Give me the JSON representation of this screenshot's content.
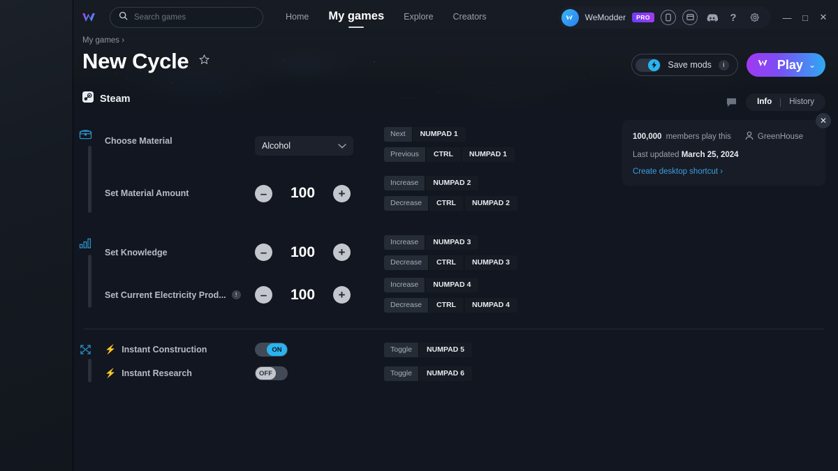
{
  "window": {
    "minimize": "—",
    "maximize": "□",
    "close": "✕"
  },
  "topbar": {
    "logo_icon": "wemod-logo-icon",
    "search": {
      "placeholder": "Search games",
      "value": "",
      "icon": "search-icon"
    },
    "nav": [
      {
        "label": "Home",
        "active": false
      },
      {
        "label": "My games",
        "active": true
      },
      {
        "label": "Explore",
        "active": false
      },
      {
        "label": "Creators",
        "active": false
      }
    ],
    "account": {
      "name": "WeModder",
      "badge": "PRO",
      "avatar_icon": "wemod-avatar-icon"
    },
    "icons": [
      {
        "name": "phone-icon"
      },
      {
        "name": "desktop-icon"
      },
      {
        "name": "discord-icon"
      },
      {
        "name": "help-icon",
        "glyph": "?"
      },
      {
        "name": "settings-gear-icon"
      }
    ]
  },
  "header": {
    "breadcrumb": "My games ",
    "breadcrumb_caret": "›",
    "title": "New Cycle",
    "favorite_icon": "star-outline-icon",
    "platform": {
      "name": "Steam",
      "icon": "steam-icon"
    },
    "save_mods": {
      "label": "Save mods",
      "state": "on",
      "info_glyph": "i",
      "bolt_icon": "bolt-icon"
    },
    "play": {
      "label": "Play",
      "caret": "⌄",
      "icon": "wemod-w-icon"
    }
  },
  "panel_tabs": {
    "chat_icon": "chat-bubble-icon",
    "tabs": [
      {
        "label": "Info",
        "active": true
      },
      {
        "label": "History",
        "active": false
      }
    ]
  },
  "info_card": {
    "members_count": "100,000",
    "members_text": "members play this",
    "author": "GreenHouse",
    "author_icon": "person-icon",
    "last_updated_label": "Last updated",
    "last_updated_date": "March 25, 2024",
    "shortcut_link": "Create desktop shortcut ›",
    "close_glyph": "✕"
  },
  "groups": [
    {
      "icon": "treasure-chest-icon",
      "rows": [
        {
          "label": "Choose Material",
          "control": {
            "type": "dropdown",
            "value": "Alcohol",
            "caret": "⌄"
          },
          "keys": [
            {
              "action": "Next",
              "combo": [
                "NUMPAD 1"
              ]
            },
            {
              "action": "Previous",
              "combo": [
                "CTRL",
                "NUMPAD 1"
              ]
            }
          ]
        },
        {
          "label": "Set Material Amount",
          "control": {
            "type": "stepper",
            "value": "100",
            "minus": "–",
            "plus": "+"
          },
          "keys": [
            {
              "action": "Increase",
              "combo": [
                "NUMPAD 2"
              ]
            },
            {
              "action": "Decrease",
              "combo": [
                "CTRL",
                "NUMPAD 2"
              ]
            }
          ]
        }
      ]
    },
    {
      "icon": "bar-chart-icon",
      "rows": [
        {
          "label": "Set Knowledge",
          "control": {
            "type": "stepper",
            "value": "100",
            "minus": "–",
            "plus": "+"
          },
          "keys": [
            {
              "action": "Increase",
              "combo": [
                "NUMPAD 3"
              ]
            },
            {
              "action": "Decrease",
              "combo": [
                "CTRL",
                "NUMPAD 3"
              ]
            }
          ]
        },
        {
          "label": "Set Current Electricity Prod...",
          "warning": "!",
          "control": {
            "type": "stepper",
            "value": "100",
            "minus": "–",
            "plus": "+"
          },
          "keys": [
            {
              "action": "Increase",
              "combo": [
                "NUMPAD 4"
              ]
            },
            {
              "action": "Decrease",
              "combo": [
                "CTRL",
                "NUMPAD 4"
              ]
            }
          ]
        }
      ]
    },
    {
      "icon": "cross-gear-icon",
      "rows": [
        {
          "label": "Instant Construction",
          "bolt": true,
          "control": {
            "type": "toggle",
            "state": "on",
            "on_label": "ON",
            "off_label": "OFF"
          },
          "keys": [
            {
              "action": "Toggle",
              "combo": [
                "NUMPAD 5"
              ]
            }
          ]
        },
        {
          "label": "Instant Research",
          "bolt": true,
          "control": {
            "type": "toggle",
            "state": "off",
            "on_label": "ON",
            "off_label": "OFF"
          },
          "keys": [
            {
              "action": "Toggle",
              "combo": [
                "NUMPAD 6"
              ]
            }
          ]
        }
      ]
    }
  ],
  "colors": {
    "accent_blue": "#2ab4ef",
    "accent_purple": "#a03af0",
    "link": "#3d9ee0",
    "bg": "#111620",
    "icon_teal": "#2a8fc4"
  }
}
